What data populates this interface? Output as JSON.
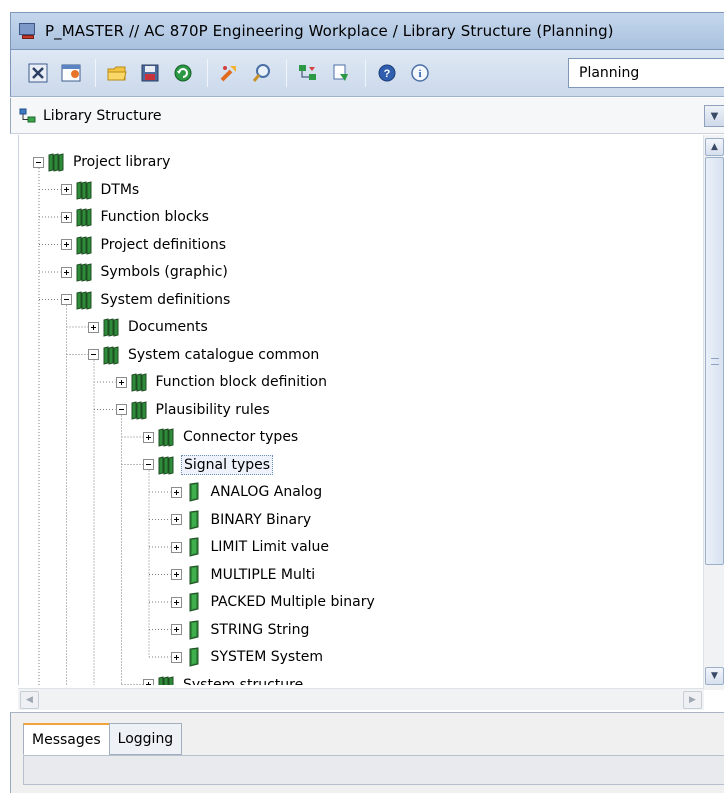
{
  "window": {
    "title": "P_MASTER // AC 870P Engineering Workplace / Library Structure (Planning)"
  },
  "toolbar": {
    "buttons": [
      {
        "name": "close-view-button",
        "icon": "close-x-icon"
      },
      {
        "name": "new-window-button",
        "icon": "new-window-icon"
      },
      {
        "name": "open-folder-button",
        "icon": "folder-icon"
      },
      {
        "name": "save-button",
        "icon": "floppy-icon"
      },
      {
        "name": "refresh-button",
        "icon": "refresh-icon"
      },
      {
        "name": "tools-button",
        "icon": "tools-icon"
      },
      {
        "name": "search-button",
        "icon": "magnifier-icon"
      },
      {
        "name": "tree-action-button",
        "icon": "tree-action-icon"
      },
      {
        "name": "filter-button",
        "icon": "filter-icon"
      },
      {
        "name": "help-button",
        "icon": "help-icon"
      },
      {
        "name": "info-button",
        "icon": "info-icon"
      }
    ],
    "mode_value": "Planning"
  },
  "panel": {
    "label": "Library Structure"
  },
  "tree": [
    {
      "label": "Project library",
      "level": 0,
      "state": "expanded",
      "book": "lib"
    },
    {
      "label": "DTMs",
      "level": 1,
      "state": "collapsed",
      "book": "lib"
    },
    {
      "label": "Function blocks",
      "level": 1,
      "state": "collapsed",
      "book": "lib"
    },
    {
      "label": "Project definitions",
      "level": 1,
      "state": "collapsed",
      "book": "lib"
    },
    {
      "label": "Symbols (graphic)",
      "level": 1,
      "state": "collapsed",
      "book": "lib"
    },
    {
      "label": "System definitions",
      "level": 1,
      "state": "expanded",
      "book": "lib"
    },
    {
      "label": "Documents",
      "level": 2,
      "state": "collapsed",
      "book": "lib"
    },
    {
      "label": "System catalogue common",
      "level": 2,
      "state": "expanded",
      "book": "lib"
    },
    {
      "label": "Function block definition",
      "level": 3,
      "state": "collapsed",
      "book": "lib"
    },
    {
      "label": "Plausibility rules",
      "level": 3,
      "state": "expanded",
      "book": "lib"
    },
    {
      "label": "Connector types",
      "level": 4,
      "state": "collapsed",
      "book": "lib"
    },
    {
      "label": "Signal types",
      "level": 4,
      "state": "expanded",
      "book": "lib",
      "selected": true
    },
    {
      "label": "ANALOG Analog",
      "level": 5,
      "state": "collapsed",
      "book": "single"
    },
    {
      "label": "BINARY Binary",
      "level": 5,
      "state": "collapsed",
      "book": "single"
    },
    {
      "label": "LIMIT Limit value",
      "level": 5,
      "state": "collapsed",
      "book": "single"
    },
    {
      "label": "MULTIPLE Multi",
      "level": 5,
      "state": "collapsed",
      "book": "single"
    },
    {
      "label": "PACKED Multiple binary",
      "level": 5,
      "state": "collapsed",
      "book": "single"
    },
    {
      "label": "STRING String",
      "level": 5,
      "state": "collapsed",
      "book": "single"
    },
    {
      "label": "SYSTEM System",
      "level": 5,
      "state": "collapsed",
      "book": "single"
    },
    {
      "label": "System structure",
      "level": 4,
      "state": "collapsed",
      "book": "lib"
    }
  ],
  "bottom_tabs": [
    {
      "label": "Messages",
      "active": true
    },
    {
      "label": "Logging",
      "active": false
    }
  ],
  "colors": {
    "book_green": "#2e8b3a",
    "book_dark": "#1f4d22",
    "title_bar": "#b7cbe6",
    "tab_accent": "#f0a43a"
  }
}
